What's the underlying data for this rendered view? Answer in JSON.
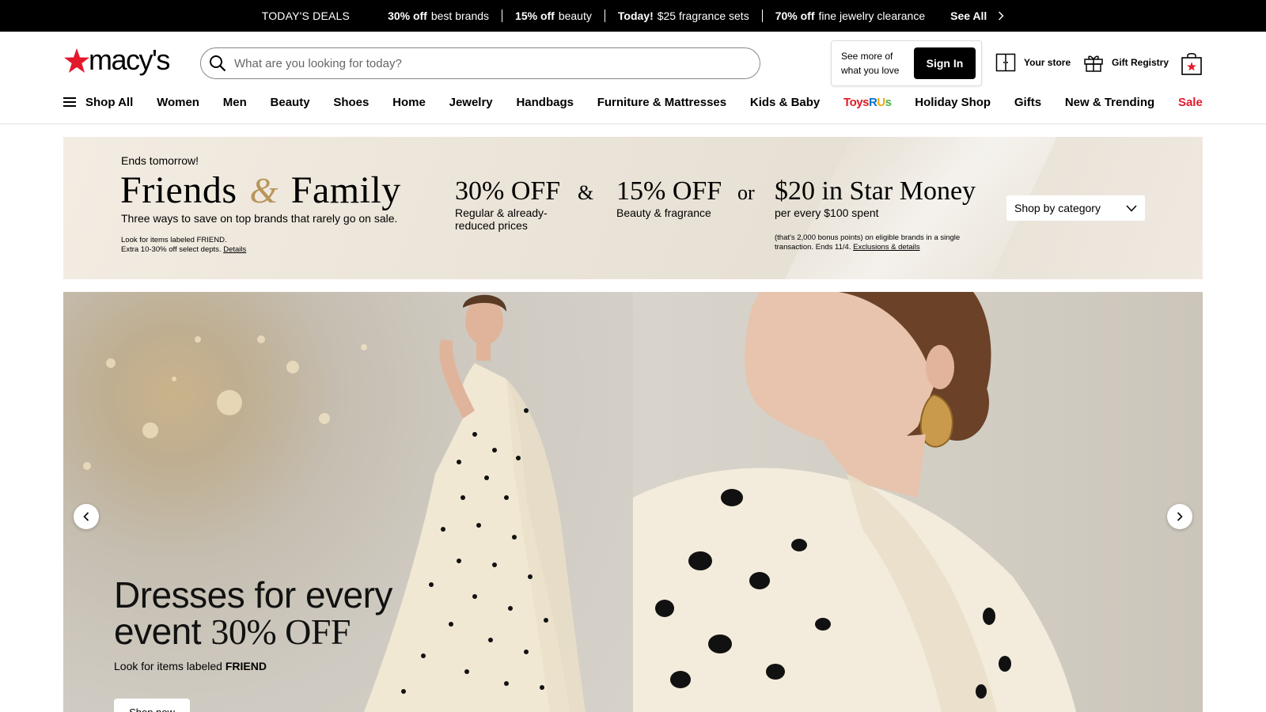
{
  "deals_bar": {
    "title": "TODAY'S DEALS",
    "deals": [
      {
        "bold": "30% off",
        "text": "best brands"
      },
      {
        "bold": "15% off",
        "text": "beauty"
      },
      {
        "bold": "Today!",
        "text": "$25 fragrance sets"
      },
      {
        "bold": "70% off",
        "text": "fine jewelry clearance"
      }
    ],
    "see_all": "See All"
  },
  "header": {
    "logo_text": "macy's",
    "search_placeholder": "What are you looking for today?",
    "signin_message_line1": "See more of",
    "signin_message_line2": "what you love",
    "signin_label": "Sign In",
    "store_label": "Your store",
    "registry_label": "Gift Registry"
  },
  "nav": {
    "shop_all": "Shop All",
    "items": [
      "Women",
      "Men",
      "Beauty",
      "Shoes",
      "Home",
      "Jewelry",
      "Handbags",
      "Furniture & Mattresses",
      "Kids & Baby"
    ],
    "toys_parts": [
      "Toys",
      "R",
      "U",
      "s"
    ],
    "items_after": [
      "Holiday Shop",
      "Gifts",
      "New & Trending"
    ],
    "sale": "Sale"
  },
  "promo": {
    "ends": "Ends tomorrow!",
    "title_left": "Friends",
    "title_amp": "&",
    "title_right": "Family",
    "subtitle": "Three ways to save on top brands that rarely go on sale.",
    "fine_line1": "Look for items labeled FRIEND.",
    "fine_line2": "Extra 10-30% off select depts.",
    "fine_link": "Details",
    "offer1_big": "30% OFF",
    "offer1_desc": "Regular & already-reduced prices",
    "conj1": "&",
    "offer2_big": "15% OFF",
    "offer2_desc": "Beauty & fragrance",
    "conj2": "or",
    "offer3_big": "$20 in Star Money",
    "offer3_desc": "per every $100 spent",
    "excl_text": "(that's 2,000 bonus points) on eligible brands in a single transaction. Ends 11/4.",
    "excl_link": "Exclusions & details",
    "shop_by_category": "Shop by category"
  },
  "hero": {
    "headline_line1": "Dresses for every",
    "headline_line2a": "event",
    "headline_line2b": "30% OFF",
    "note_prefix": "Look for items labeled",
    "note_bold": "FRIEND",
    "cta": "Shop now"
  },
  "colors": {
    "brand_red": "#e21a2c",
    "deals_bar_bg": "#000000",
    "amp_gold": "#b8955a"
  },
  "icons": [
    "search-icon",
    "store-icon",
    "gift-icon",
    "bag-icon",
    "menu-icon",
    "chevron-right-icon",
    "chevron-left-icon",
    "chevron-down-icon",
    "star-logo-icon"
  ]
}
